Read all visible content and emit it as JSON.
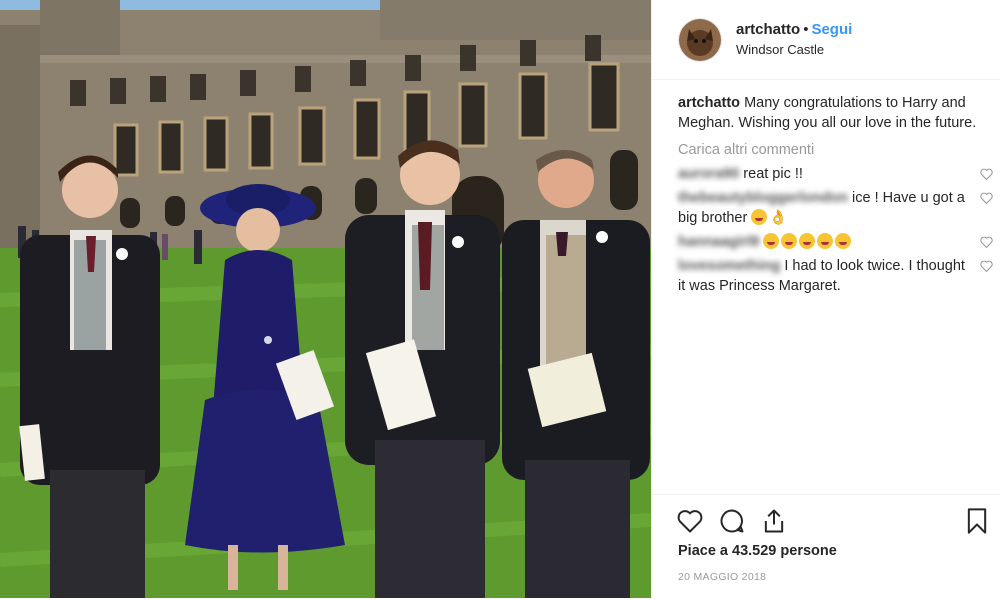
{
  "post": {
    "username": "artchatto",
    "separator": "•",
    "follow_label": "Segui",
    "location": "Windsor Castle"
  },
  "caption": {
    "username": "artchatto",
    "text": "Many congratulations to Harry and Meghan. Wishing you all our love in the future."
  },
  "load_more_label": "Carica altri commenti",
  "comments": [
    {
      "username_blurred": "aurora90",
      "text": "reat pic !!"
    },
    {
      "username_blurred": "thebeautybloggerlondon",
      "text": "ice ! Have u got a big brother"
    },
    {
      "username_blurred": "hannaagirl8",
      "text": ""
    },
    {
      "username_blurred": "lovesomething",
      "text": "I had to look twice. I thought it was Princess Margaret."
    }
  ],
  "likes_text": "Piace a 43.529 persone",
  "date": "20 MAGGIO 2018",
  "icons": {
    "like": "heart-icon",
    "comment": "comment-icon",
    "share": "share-icon",
    "save": "bookmark-icon"
  },
  "colors": {
    "link": "#3897f0",
    "text": "#262626",
    "muted": "#999999"
  }
}
